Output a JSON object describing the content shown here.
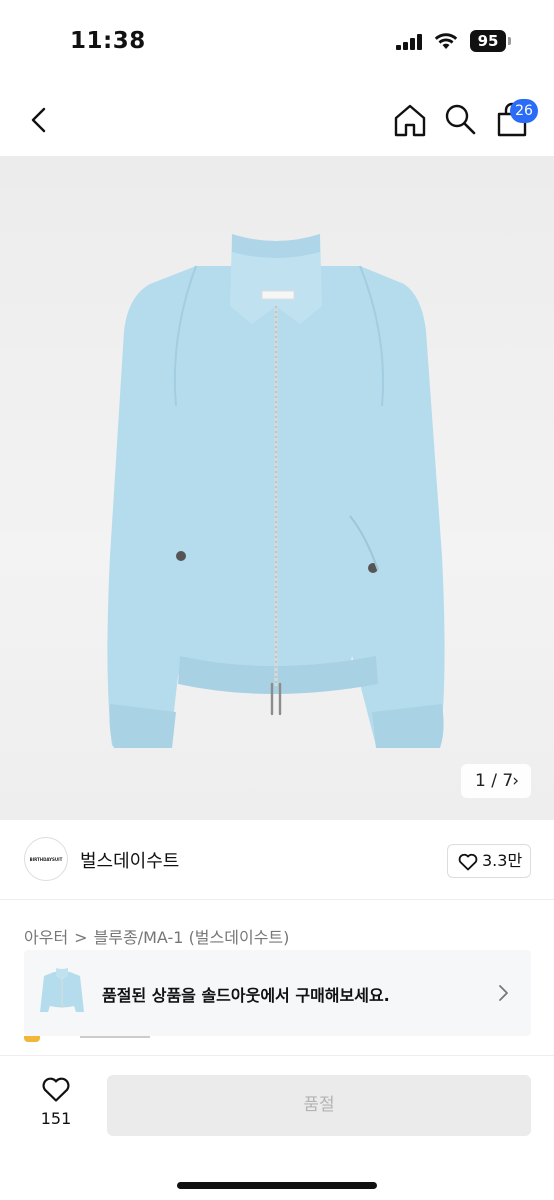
{
  "status_bar": {
    "time": "11:38",
    "battery": "95",
    "icons": [
      "signal-icon",
      "wifi-icon",
      "battery-icon"
    ]
  },
  "nav": {
    "icons": [
      "chevron-left-icon",
      "home-icon",
      "search-icon",
      "shopping-bag-icon"
    ],
    "cart_count": "26"
  },
  "gallery": {
    "image": "light blue zip-up bomber jacket",
    "page_current": "1",
    "page_total": "7",
    "indicator": "1 / 7",
    "chevron": "›"
  },
  "brand": {
    "logo_text": "BIRTHDAYSUIT",
    "name": "벌스데이수트",
    "likes": "3.3만"
  },
  "breadcrumb": {
    "category": "아우터",
    "separator": ">",
    "subcategory": "블루종/MA-1 (벌스데이수트)"
  },
  "promo": {
    "text": "품절된 상품을 솔드아웃에서 구매해보세요."
  },
  "bottom_bar": {
    "wish_count": "151",
    "button_label": "품절"
  },
  "colors": {
    "accent": "#2a6cf6",
    "jacket": "#b5dcec",
    "disabled_button": "#ebebeb",
    "disabled_text": "#b3b3b3"
  }
}
